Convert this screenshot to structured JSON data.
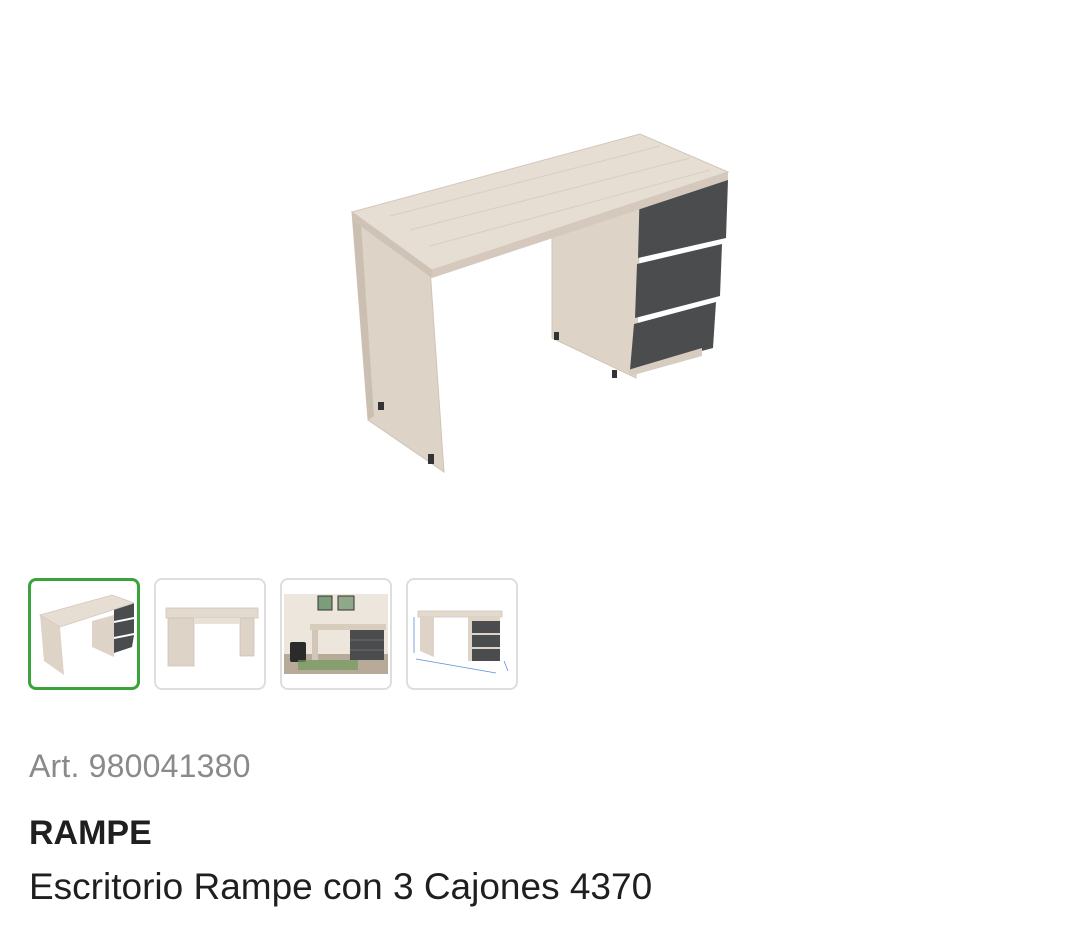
{
  "product": {
    "main_image_name": "desk-product-image",
    "article": "Art. 980041380",
    "brand": "RAMPE",
    "title": "Escritorio Rampe con 3 Cajones 4370"
  },
  "gallery": {
    "thumbnails": [
      {
        "name": "thumbnail-desk-angled",
        "selected": true
      },
      {
        "name": "thumbnail-desk-front",
        "selected": false
      },
      {
        "name": "thumbnail-desk-room",
        "selected": false
      },
      {
        "name": "thumbnail-desk-dimensions",
        "selected": false
      }
    ]
  },
  "colors": {
    "selected_border": "#3aa33c",
    "thumb_border": "#dedede",
    "wood": "#e2d9cf",
    "drawer": "#4a4c4e"
  }
}
